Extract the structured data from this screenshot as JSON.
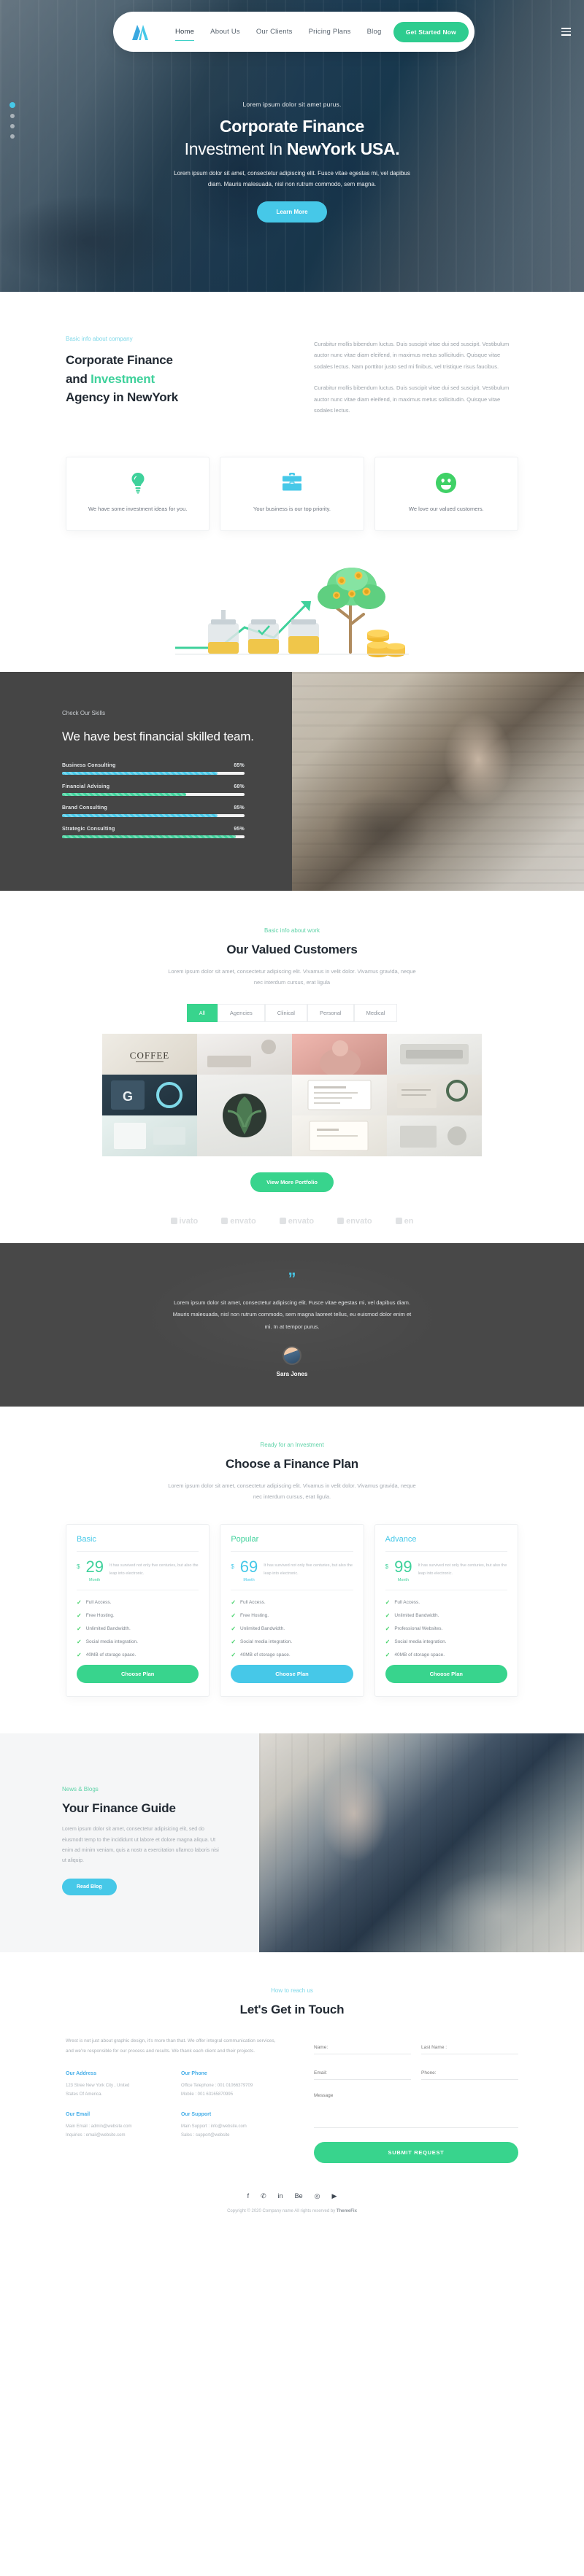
{
  "nav": {
    "logo": "logo-mark",
    "links": [
      {
        "label": "Home",
        "active": true
      },
      {
        "label": "About Us",
        "active": false
      },
      {
        "label": "Our Clients",
        "active": false
      },
      {
        "label": "Pricing Plans",
        "active": false
      },
      {
        "label": "Blog",
        "active": false
      }
    ],
    "cta": "Get Started Now",
    "menu_icon": "hamburger-menu-icon"
  },
  "hero": {
    "subtitle": "Lorem ipsum dolor sit amet purus.",
    "title_line1": "Corporate Finance",
    "title_line2_thin": "Investment In ",
    "title_line2_bold": "NewYork USA.",
    "paragraph": "Lorem ipsum dolor sit amet, consectetur adipiscing elit. Fusce vitae egestas mi, vel dapibus diam. Mauris malesuada, nisl non rutrum commodo, sem magna.",
    "button": "Learn More"
  },
  "about": {
    "eyebrow": "Basic info about company",
    "title_1": "Corporate Finance",
    "title_2_plain": "and ",
    "title_2_accent": "Investment",
    "title_3": "Agency in NewYork",
    "paragraph1": "Curabitur mollis bibendum luctus. Duis suscipit vitae dui sed suscipit. Vestibulum auctor nunc vitae diam eleifend, in maximus metus sollicitudin. Quisque vitae sodales lectus. Nam porttitor justo sed mi finibus, vel tristique risus faucibus.",
    "paragraph2": "Curabitur mollis bibendum luctus. Duis suscipit vitae dui sed suscipit. Vestibulum auctor nunc vitae diam eleifend, in maximus metus sollicitudin. Quisque vitae sodales lectus.",
    "features": [
      {
        "icon": "lightbulb-icon",
        "text": "We have some investment ideas for you.",
        "color": "#3fd19b"
      },
      {
        "icon": "briefcase-icon",
        "text": "Your business is our top priority.",
        "color": "#46c8e8"
      },
      {
        "icon": "smiley-face-icon",
        "text": "We love our valued customers.",
        "color": "#3fd166"
      }
    ]
  },
  "skills": {
    "eyebrow": "Check Our Skills",
    "title": "We have best financial skilled team.",
    "bars": [
      {
        "label": "Business Consulting",
        "value": "85%",
        "pct": 85,
        "color": "#46c8e8"
      },
      {
        "label": "Financial Advising",
        "value": "68%",
        "pct": 68,
        "color": "#3fd19b"
      },
      {
        "label": "Brand Consulting",
        "value": "85%",
        "pct": 85,
        "color": "#46c8e8"
      },
      {
        "label": "Strategic Consulting",
        "value": "95%",
        "pct": 95,
        "color": "#3fd19b"
      }
    ]
  },
  "portfolio": {
    "eyebrow": "Basic info about work",
    "title": "Our Valued Customers",
    "paragraph": "Lorem ipsum dolor sit amet, consectetur adipiscing elit. Vivamus in velit dolor. Vivamus gravida, neque nec interdum cursus, erat ligula",
    "filters": [
      {
        "label": "All",
        "active": true
      },
      {
        "label": "Agencies",
        "active": false
      },
      {
        "label": "Clinical",
        "active": false
      },
      {
        "label": "Personal",
        "active": false
      },
      {
        "label": "Medical",
        "active": false
      }
    ],
    "button": "View More Portfolio",
    "brands": [
      "ivato",
      "envato",
      "envato",
      "envato",
      "en"
    ]
  },
  "testimonial": {
    "quote_icon": "quotation-mark-icon",
    "text": "Lorem ipsum dolor sit amet, consectetur adipiscing elit. Fusce vitae egestas mi, vel dapibus diam. Mauris malesuada, nisl non rutrum commodo, sem magna laoreet tellus, eu euismod dolor enim et mi. In at tempor purus.",
    "name": "Sara Jones"
  },
  "pricing": {
    "eyebrow": "Ready for an Investment",
    "title": "Choose a Finance Plan",
    "paragraph": "Lorem ipsum dolor sit amet, consectetur adipiscing elit. Vivamus in velit dolor. Vivamus gravida, neque nec interdum cursus, erat ligula.",
    "plans": [
      {
        "name": "Basic",
        "name_color": "#46c8e8",
        "currency": "$",
        "amount": "29",
        "per": "Month",
        "note": "It has survived not only five centuries, but also the leap into electronic.",
        "amount_color": "#3fd19b",
        "features": [
          "Full Access.",
          "Free Hosting.",
          "Unlimited Bandwidth.",
          "Social media integration.",
          "40MB of storage space."
        ],
        "button": "Choose Plan",
        "button_color": "#38d48d"
      },
      {
        "name": "Popular",
        "name_color": "#3fd19b",
        "currency": "$",
        "amount": "69",
        "per": "Month",
        "note": "It has survived not only five centuries, but also the leap into electronic.",
        "amount_color": "#46c8e8",
        "features": [
          "Full Access.",
          "Free Hosting.",
          "Unlimited Bandwidth.",
          "Social media integration.",
          "40MB of storage space."
        ],
        "button": "Choose Plan",
        "button_color": "#46c8e8"
      },
      {
        "name": "Advance",
        "name_color": "#46c8e8",
        "currency": "$",
        "amount": "99",
        "per": "Month",
        "note": "It has survived not only five centuries, but also the leap into electronic.",
        "amount_color": "#3fd19b",
        "features": [
          "Full Access.",
          "Unlimited Bandwidth.",
          "Professional Websites.",
          "Social media integration.",
          "40MB of storage space."
        ],
        "button": "Choose Plan",
        "button_color": "#38d48d"
      }
    ]
  },
  "blog": {
    "eyebrow": "News & Blogs",
    "title": "Your Finance Guide",
    "paragraph": "Lorem ipsum dolor sit amet, consectetur adipisicing elit, sed do eiusmodt temp to the incididunt ut labore et dolore magna aliqua. Ut enim ad minim veniam, quis a nostr a exercitation ullamco laboris nisi ut aliquip.",
    "button": "Read Blog"
  },
  "contact": {
    "eyebrow": "How to reach us",
    "title": "Let's Get in Touch",
    "intro": "Wrest is not just about graphic design, it's more than that. We offer integral communication services, and we're responsible for our process and results. We thank each client and their projects.",
    "blocks": [
      {
        "title": "Our Address",
        "line1": "123 Stree New York City , United",
        "line2": "States Of America."
      },
      {
        "title": "Our Phone",
        "line1": "Office Telephone : 001 01066379709",
        "line2": "Mobile : 001 63165870995"
      },
      {
        "title": "Our Email",
        "line1": "Main Email : admin@website.com",
        "line2": "Inquiries : email@website.com"
      },
      {
        "title": "Our Support",
        "line1": "Main Support : info@website.com",
        "line2": "Sales : support@website"
      }
    ],
    "form": {
      "name_placeholder": "Name:",
      "lastname_placeholder": "Last Name :",
      "email_placeholder": "Email:",
      "phone_placeholder": "Phone:",
      "message_placeholder": "Message",
      "submit": "SUBMIT REQUEST"
    }
  },
  "footer": {
    "socials": [
      "facebook-icon",
      "twitter-icon",
      "linkedin-icon",
      "behance-icon",
      "instagram-icon",
      "youtube-icon"
    ],
    "social_glyphs": [
      "f",
      "✆",
      "in",
      "Be",
      "◎",
      "▶"
    ],
    "copyright_prefix": "Copyright ",
    "copyright_text": "© 2020 Company name All rights reserved by ",
    "copyright_brand": "ThemeFix"
  },
  "colors": {
    "green": "#3fd19b",
    "green_btn": "#38d48d",
    "blue": "#46c8e8",
    "dark": "#454545",
    "text": "#4a4a4a"
  }
}
